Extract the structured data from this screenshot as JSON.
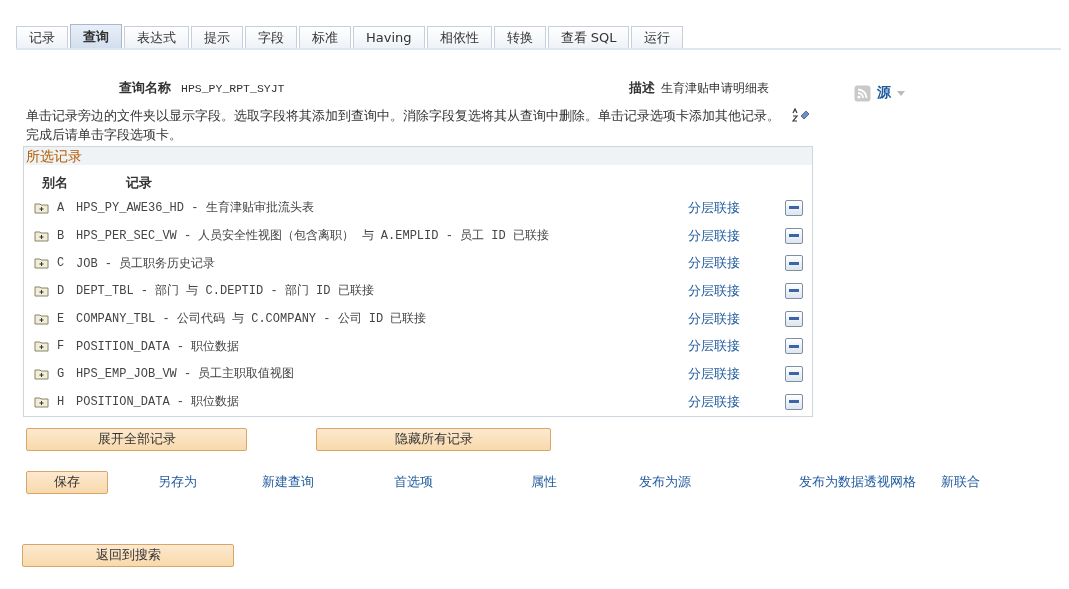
{
  "tabs": [
    {
      "label": "记录",
      "selected": false
    },
    {
      "label": "查询",
      "selected": true
    },
    {
      "label": "表达式",
      "selected": false
    },
    {
      "label": "提示",
      "selected": false
    },
    {
      "label": "字段",
      "selected": false
    },
    {
      "label": "标准",
      "selected": false
    },
    {
      "label": "Having",
      "selected": false
    },
    {
      "label": "相依性",
      "selected": false
    },
    {
      "label": "转换",
      "selected": false
    },
    {
      "label": "查看 SQL",
      "selected": false
    },
    {
      "label": "运行",
      "selected": false
    }
  ],
  "query_name": {
    "label": "查询名称",
    "value": "HPS_PY_RPT_SYJT"
  },
  "description": {
    "label": "描述",
    "value": "生育津贴申请明细表"
  },
  "feed": {
    "label": "源"
  },
  "instructions": [
    "单击记录旁边的文件夹以显示字段。选取字段将其添加到查询中。消除字段复选将其从查询中删除。单击记录选项卡添加其他记录。",
    "完成后请单击字段选项卡。"
  ],
  "selected_records": {
    "title": "所选记录",
    "columns": [
      "别名",
      "记录"
    ],
    "rows": [
      {
        "alias": "A",
        "record": "HPS_PY_AWE36_HD - 生育津贴审批流头表",
        "link": "分层联接"
      },
      {
        "alias": "B",
        "record": "HPS_PER_SEC_VW - 人员安全性视图（包含离职） 与 A.EMPLID - 员工 ID 已联接",
        "link": "分层联接"
      },
      {
        "alias": "C",
        "record": "JOB - 员工职务历史记录",
        "link": "分层联接"
      },
      {
        "alias": "D",
        "record": "DEPT_TBL - 部门 与 C.DEPTID - 部门 ID 已联接",
        "link": "分层联接"
      },
      {
        "alias": "E",
        "record": "COMPANY_TBL - 公司代码 与 C.COMPANY - 公司 ID 已联接",
        "link": "分层联接"
      },
      {
        "alias": "F",
        "record": "POSITION_DATA - 职位数据",
        "link": "分层联接"
      },
      {
        "alias": "G",
        "record": "HPS_EMP_JOB_VW - 员工主职取值视图",
        "link": "分层联接"
      },
      {
        "alias": "H",
        "record": "POSITION_DATA - 职位数据",
        "link": "分层联接"
      }
    ]
  },
  "record_buttons": [
    "展开全部记录",
    "隐藏所有记录"
  ],
  "save_button": "保存",
  "actions": [
    "另存为",
    "新建查询",
    "首选项",
    "属性",
    "发布为源",
    "发布为数据透视网格",
    "新联合"
  ],
  "back_button": "返回到搜索"
}
